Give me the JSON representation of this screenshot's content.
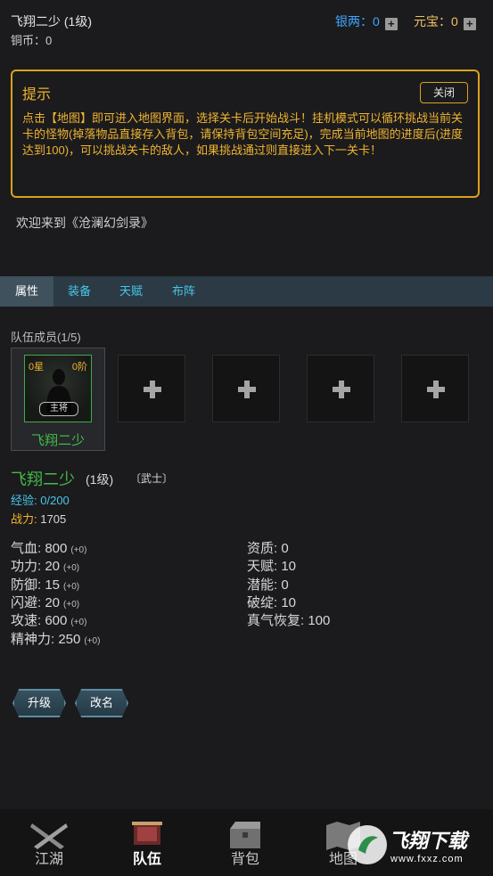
{
  "header": {
    "player_name": "飞翔二少 (1级)",
    "copper_label": "铜币：",
    "copper_value": "0",
    "silver_label": "银两：",
    "silver_value": "0",
    "yuanbao_label": "元宝：",
    "yuanbao_value": "0"
  },
  "tip": {
    "title": "提示",
    "close_label": "关闭",
    "text": "点击【地图】即可进入地图界面，选择关卡后开始战斗！挂机模式可以循环挑战当前关卡的怪物(掉落物品直接存入背包，请保持背包空间充足)，完成当前地图的进度后(进度达到100)，可以挑战关卡的敌人，如果挑战通过则直接进入下一关卡！"
  },
  "log": {
    "welcome": "欢迎来到《沧澜幻剑录》"
  },
  "tabs": [
    {
      "label": "属性",
      "active": true
    },
    {
      "label": "装备",
      "active": false
    },
    {
      "label": "天赋",
      "active": false
    },
    {
      "label": "布阵",
      "active": false
    }
  ],
  "team": {
    "label": "队伍成员(1/5)",
    "leader": {
      "name": "飞翔二少",
      "stars": "0星",
      "rank": "0阶",
      "badge": "主将"
    }
  },
  "hero": {
    "name": "飞翔二少",
    "level": "(1级)",
    "class": "〔武士〕",
    "exp_label": "经验:",
    "exp_value": "0/200",
    "power_label": "战力:",
    "power_value": "1705",
    "stats_left": [
      {
        "label": "气血:",
        "value": "800",
        "bonus": "(+0)"
      },
      {
        "label": "功力:",
        "value": "20",
        "bonus": "(+0)"
      },
      {
        "label": "防御:",
        "value": "15",
        "bonus": "(+0)"
      },
      {
        "label": "闪避:",
        "value": "20",
        "bonus": "(+0)"
      },
      {
        "label": "攻速:",
        "value": "600",
        "bonus": "(+0)"
      },
      {
        "label": "精神力:",
        "value": "250",
        "bonus": "(+0)"
      }
    ],
    "stats_right": [
      {
        "label": "资质:",
        "value": "0"
      },
      {
        "label": "天赋:",
        "value": "10"
      },
      {
        "label": "潜能:",
        "value": "0"
      },
      {
        "label": "破绽:",
        "value": "10"
      },
      {
        "label": "真气恢复:",
        "value": "100"
      }
    ]
  },
  "actions": {
    "upgrade": "升级",
    "rename": "改名"
  },
  "nav": [
    {
      "label": "江湖",
      "icon": "swords-icon",
      "active": false
    },
    {
      "label": "队伍",
      "icon": "banner-icon",
      "active": true
    },
    {
      "label": "背包",
      "icon": "chest-icon",
      "active": false
    },
    {
      "label": "地图",
      "icon": "map-icon",
      "active": false
    }
  ],
  "watermark": {
    "text": "飞翔下载",
    "url": "www.fxxz.com"
  },
  "colors": {
    "accent_gold": "#f0b430",
    "accent_cyan": "#48c7e8",
    "hero_green": "#45b84a",
    "silver_blue": "#3fa6ff"
  }
}
